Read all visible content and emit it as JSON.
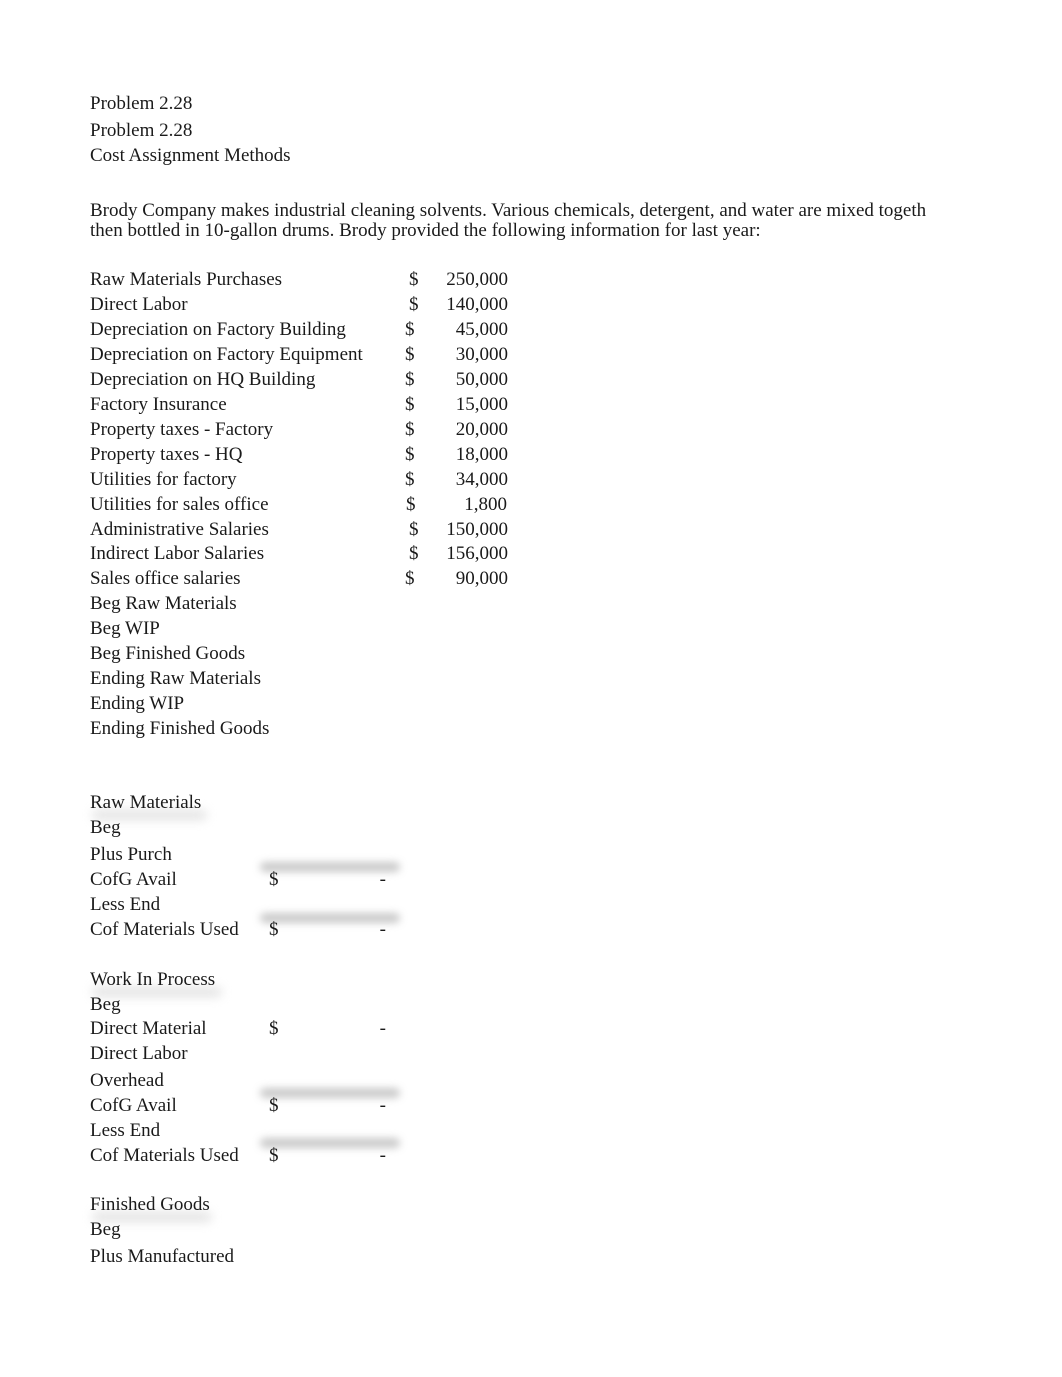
{
  "header": {
    "title_1": "Problem 2.28",
    "title_2": "Problem 2.28",
    "subtitle": "Cost Assignment Methods"
  },
  "intro": {
    "line_1": "Brody Company makes industrial cleaning solvents. Various chemicals, detergent, and water are mixed togeth",
    "line_2": "then bottled in 10-gallon drums. Brody provided the following information for last year:"
  },
  "cost_items": [
    {
      "label": "Raw Materials Purchases",
      "currency": "$",
      "amount": "250,000"
    },
    {
      "label": "Direct Labor",
      "currency": "$",
      "amount": "140,000"
    },
    {
      "label": "Depreciation on Factory Building",
      "currency": "$",
      "amount": "45,000"
    },
    {
      "label": "Depreciation on Factory Equipment",
      "currency": "$",
      "amount": "30,000"
    },
    {
      "label": "Depreciation on HQ Building",
      "currency": "$",
      "amount": "50,000"
    },
    {
      "label": "Factory Insurance",
      "currency": "$",
      "amount": "15,000"
    },
    {
      "label": "Property taxes - Factory",
      "currency": "$",
      "amount": "20,000"
    },
    {
      "label": "Property taxes - HQ",
      "currency": "$",
      "amount": "18,000"
    },
    {
      "label": "Utilities for factory",
      "currency": "$",
      "amount": "34,000"
    },
    {
      "label": "Utilities for sales office",
      "currency": "$",
      "amount": "1,800"
    },
    {
      "label": "Administrative Salaries",
      "currency": "$",
      "amount": "150,000"
    },
    {
      "label": "Indirect Labor Salaries",
      "currency": "$",
      "amount": "156,000"
    },
    {
      "label": "Sales office salaries",
      "currency": "$",
      "amount": "90,000"
    },
    {
      "label": "Beg Raw Materials",
      "currency": "",
      "amount": ""
    },
    {
      "label": "Beg WIP",
      "currency": "",
      "amount": ""
    },
    {
      "label": "Beg Finished Goods",
      "currency": "",
      "amount": ""
    },
    {
      "label": "Ending Raw Materials",
      "currency": "",
      "amount": ""
    },
    {
      "label": "Ending WIP",
      "currency": "",
      "amount": ""
    },
    {
      "label": "Ending Finished Goods",
      "currency": "",
      "amount": ""
    }
  ],
  "raw_materials": {
    "heading": "Raw Materials",
    "rows": [
      {
        "label": "Beg",
        "currency": "",
        "amount": ""
      },
      {
        "label": "Plus Purch",
        "currency": "",
        "amount": ""
      },
      {
        "label": "CofG Avail",
        "currency": "$",
        "amount": "-"
      },
      {
        "label": "Less End",
        "currency": "",
        "amount": ""
      },
      {
        "label": "Cof Materials Used",
        "currency": "$",
        "amount": "-"
      }
    ]
  },
  "work_in_process": {
    "heading": "Work In Process",
    "rows": [
      {
        "label": "Beg",
        "currency": "",
        "amount": ""
      },
      {
        "label": "Direct Material",
        "currency": "$",
        "amount": "-"
      },
      {
        "label": "Direct Labor",
        "currency": "",
        "amount": ""
      },
      {
        "label": "Overhead",
        "currency": "",
        "amount": ""
      },
      {
        "label": "CofG Avail",
        "currency": "$",
        "amount": "-"
      },
      {
        "label": "Less End",
        "currency": "",
        "amount": ""
      },
      {
        "label": "Cof Materials Used",
        "currency": "$",
        "amount": "-"
      }
    ]
  },
  "finished_goods": {
    "heading": "Finished Goods",
    "rows": [
      {
        "label": "Beg",
        "currency": "",
        "amount": ""
      },
      {
        "label": "Plus Manufactured",
        "currency": "",
        "amount": ""
      }
    ]
  }
}
